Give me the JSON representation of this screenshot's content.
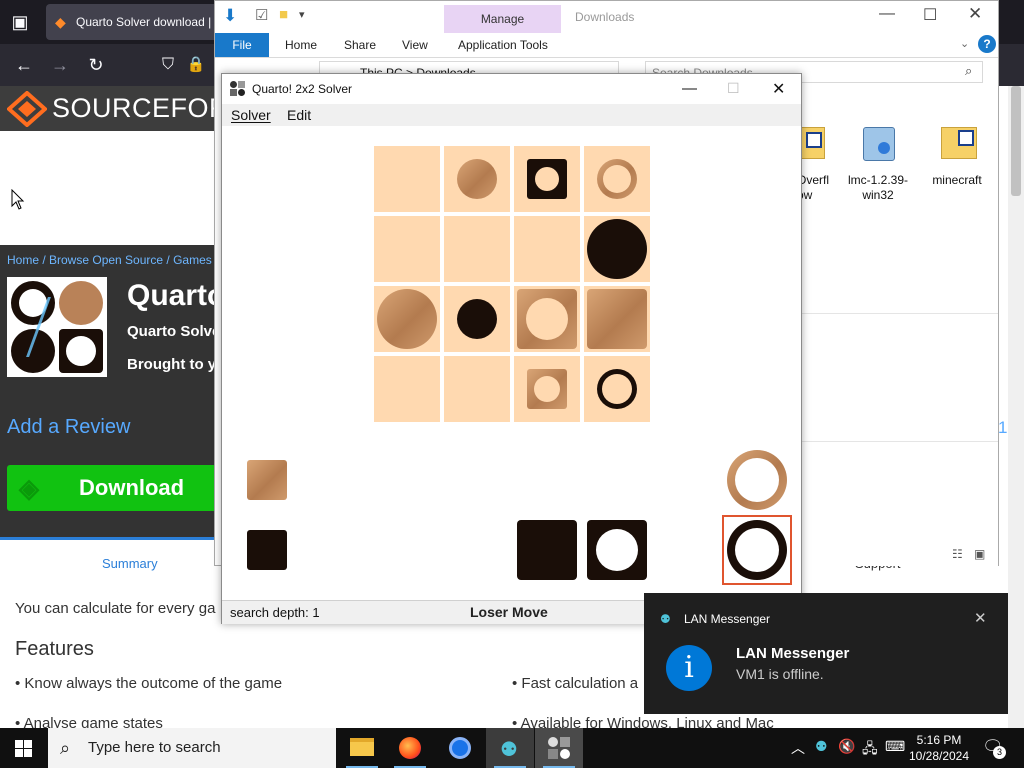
{
  "browser": {
    "tab_title": "Quarto Solver download |",
    "site_logo_text": "SOURCEFORG",
    "breadcrumb": "Home / Browse Open Source / Games /",
    "project_title": "Quarto",
    "project_subtitle": "Quarto Solve",
    "brought_by": "Brought to y",
    "add_review": "Add a Review",
    "download": "Download",
    "summary_tab": "Summary",
    "support_tab": "Support",
    "body_text": "You can calculate for every ga",
    "features_heading": "Features",
    "feature_1": "• Know always the outcome of the game",
    "feature_2": "• Fast calculation a",
    "feature_3": "• Analyse game states",
    "feature_4": "• Available for Windows, Linux and Mac",
    "right_num": "1"
  },
  "explorer": {
    "manage_tab": "Manage",
    "title": "Downloads",
    "file_tab": "File",
    "tabs": [
      "Home",
      "Share",
      "View",
      "Application Tools"
    ],
    "address_path": "This PC  >  Downloads",
    "search_placeholder": "Search Downloads",
    "files": [
      {
        "name": "Overfl\now",
        "icon": "zip-folder-icon"
      },
      {
        "name": "lmc-1.2.39-\nwin32",
        "icon": "installer-icon"
      },
      {
        "name": "minecraft",
        "icon": "zip-folder-icon"
      }
    ]
  },
  "quarto": {
    "title": "Quarto! 2x2 Solver",
    "menu": [
      "Solver",
      "Edit"
    ],
    "status_depth": "search depth: 1",
    "status_move": "Loser Move"
  },
  "toast": {
    "app_name": "LAN Messenger",
    "title": "LAN Messenger",
    "message": "VM1 is offline."
  },
  "taskbar": {
    "search_placeholder": "Type here to search",
    "time": "5:16 PM",
    "date": "10/28/2024",
    "notification_count": "3"
  },
  "colors": {
    "accent": "#1979ca",
    "download_green": "#11c211",
    "board_cell": "#ffd9b0",
    "selected_border": "#e0552f"
  }
}
